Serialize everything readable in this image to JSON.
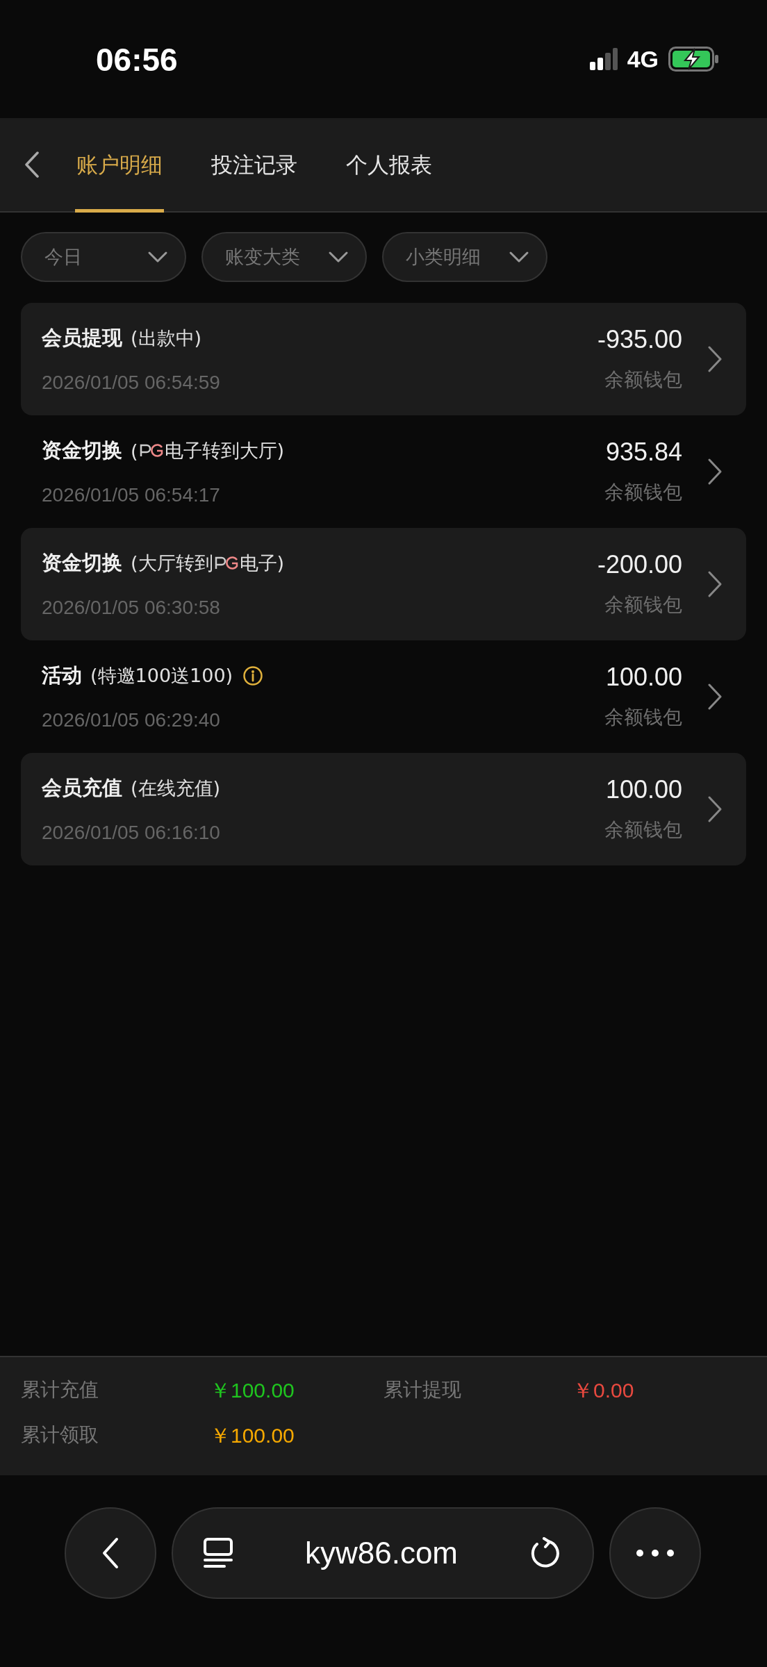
{
  "status_bar": {
    "time": "06:56",
    "network": "4G"
  },
  "tabs": [
    {
      "label": "账户明细",
      "selected": true
    },
    {
      "label": "投注记录",
      "selected": false
    },
    {
      "label": "个人报表",
      "selected": false
    }
  ],
  "filters": [
    {
      "label": "今日"
    },
    {
      "label": "账变大类"
    },
    {
      "label": "小类明细"
    }
  ],
  "records": [
    {
      "title": "会员提现",
      "note": [
        {
          "kind": "text",
          "text": "(出款中)"
        }
      ],
      "info": false,
      "date": "2026/01/05 06:54:59",
      "amount": "-935.00",
      "wallet": "余额钱包",
      "shaded": true
    },
    {
      "title": "资金切换",
      "note": [
        {
          "kind": "text",
          "text": "("
        },
        {
          "kind": "pg_logo"
        },
        {
          "kind": "text",
          "text": "电子转到大厅)"
        }
      ],
      "info": false,
      "date": "2026/01/05 06:54:17",
      "amount": "935.84",
      "wallet": "余额钱包",
      "shaded": false
    },
    {
      "title": "资金切换",
      "note": [
        {
          "kind": "text",
          "text": "(大厅转到"
        },
        {
          "kind": "pg_logo"
        },
        {
          "kind": "text",
          "text": "电子)"
        }
      ],
      "info": false,
      "date": "2026/01/05 06:30:58",
      "amount": "-200.00",
      "wallet": "余额钱包",
      "shaded": true
    },
    {
      "title": "活动",
      "note": [
        {
          "kind": "text",
          "text": "(特邀100送100)"
        }
      ],
      "info": true,
      "date": "2026/01/05 06:29:40",
      "amount": "100.00",
      "wallet": "余额钱包",
      "shaded": false
    },
    {
      "title": "会员充值",
      "note": [
        {
          "kind": "text",
          "text": "(在线充值)"
        }
      ],
      "info": false,
      "date": "2026/01/05 06:16:10",
      "amount": "100.00",
      "wallet": "余额钱包",
      "shaded": true
    }
  ],
  "summary": [
    {
      "label": "累计充值",
      "value": "￥100.00",
      "color": "#1fc41f"
    },
    {
      "label": "累计提现",
      "value": "￥0.00",
      "color": "#e8493f"
    },
    {
      "label": "累计领取",
      "value": "￥100.00",
      "color": "#f5a800"
    }
  ],
  "browser_bar": {
    "url": "kyw86.com"
  }
}
